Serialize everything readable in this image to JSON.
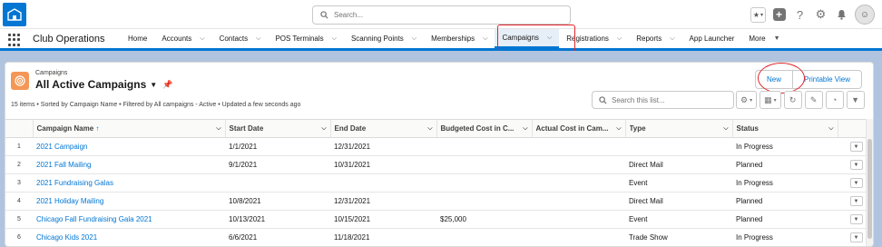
{
  "header": {
    "search_placeholder": "Search...",
    "logo_label": "Club"
  },
  "app_nav": {
    "app_name": "Club Operations",
    "items": [
      {
        "label": "Home",
        "chevron": false
      },
      {
        "label": "Accounts",
        "chevron": true
      },
      {
        "label": "Contacts",
        "chevron": true
      },
      {
        "label": "POS Terminals",
        "chevron": true
      },
      {
        "label": "Scanning Points",
        "chevron": true
      },
      {
        "label": "Memberships",
        "chevron": true
      },
      {
        "label": "Campaigns",
        "chevron": true,
        "active": true
      },
      {
        "label": "Registrations",
        "chevron": true
      },
      {
        "label": "Reports",
        "chevron": true
      },
      {
        "label": "App Launcher",
        "chevron": false
      },
      {
        "label": "More",
        "chevron": true,
        "caret": true
      }
    ]
  },
  "list_view": {
    "object_label": "Campaigns",
    "title": "All Active Campaigns",
    "summary": "15 items • Sorted by Campaign Name • Filtered by All campaigns - Active • Updated a few seconds ago",
    "buttons": {
      "new": "New",
      "printable": "Printable View"
    },
    "search_placeholder": "Search this list...",
    "columns": [
      "Campaign Name",
      "Start Date",
      "End Date",
      "Budgeted Cost in C...",
      "Actual Cost in Cam...",
      "Type",
      "Status"
    ],
    "rows": [
      {
        "num": "1",
        "name": "2021 Campaign",
        "start": "1/1/2021",
        "end": "12/31/2021",
        "budget": "",
        "actual": "",
        "type": "",
        "status": "In Progress"
      },
      {
        "num": "2",
        "name": "2021 Fall Mailing",
        "start": "9/1/2021",
        "end": "10/31/2021",
        "budget": "",
        "actual": "",
        "type": "Direct Mail",
        "status": "Planned"
      },
      {
        "num": "3",
        "name": "2021 Fundraising Galas",
        "start": "",
        "end": "",
        "budget": "",
        "actual": "",
        "type": "Event",
        "status": "In Progress"
      },
      {
        "num": "4",
        "name": "2021 Holiday Mailing",
        "start": "10/8/2021",
        "end": "12/31/2021",
        "budget": "",
        "actual": "",
        "type": "Direct Mail",
        "status": "Planned"
      },
      {
        "num": "5",
        "name": "Chicago Fall Fundraising Gala 2021",
        "start": "10/13/2021",
        "end": "10/15/2021",
        "budget": "$25,000",
        "actual": "",
        "type": "Event",
        "status": "Planned"
      },
      {
        "num": "6",
        "name": "Chicago Kids 2021",
        "start": "6/6/2021",
        "end": "11/18/2021",
        "budget": "",
        "actual": "",
        "type": "Trade Show",
        "status": "In Progress"
      }
    ]
  },
  "colors": {
    "brand": "#0176d3",
    "annotation": "#e0262d",
    "campaign_icon": "#f49756"
  }
}
